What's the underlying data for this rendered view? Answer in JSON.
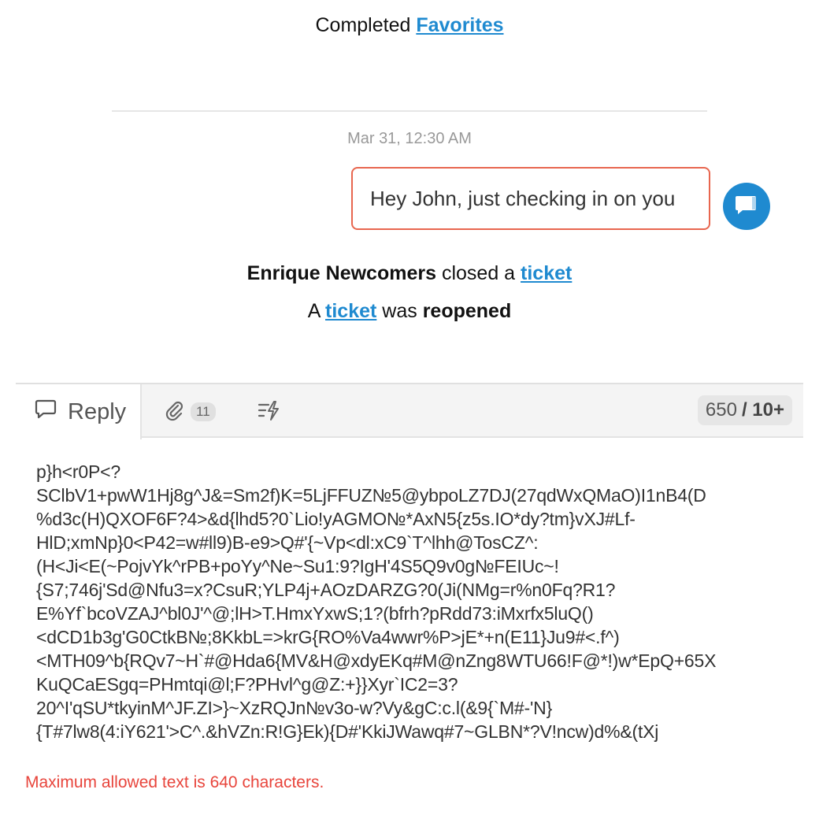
{
  "activity_top": {
    "prefix": "Completed",
    "link": "Favorites"
  },
  "timestamp": "Mar 31, 12:30 AM",
  "message": {
    "text": "Hey John, just checking in on you"
  },
  "events": [
    {
      "actor": "Enrique Newcomers",
      "action": "closed a",
      "link": "ticket"
    },
    {
      "prefix": "A",
      "link": "ticket",
      "middle": "was",
      "status": "reopened"
    }
  ],
  "composer": {
    "reply_label": "Reply",
    "attachment_count": "11",
    "counter_current": "650",
    "counter_limit": "/ 10+",
    "body_lines": [
      "p}h<r0P<?",
      "SClbV1+pwW1Hj8g^J&=Sm2f)K=5LjFFUZ№5@ybpoLZ7DJ(27qdWxQMaO)I1nB4(D",
      "%d3c(H)QXOF6F?4>&d{lhd5?0`Lio!yAGMO№*AxN5{z5s.IO*dy?tm}vXJ#Lf-",
      "HlD;xmNp}0<P42=w#ll9)B-e9>Q#'{~Vp<dl:xC9`T^lhh@TosCZ^:",
      "(H<Ji<E(~PojvYk^rPB+poYy^Ne~Su1:9?IgH'4S5Q9v0g№FEIUc~!",
      "{S7;746j'Sd@Nfu3=x?CsuR;YLP4j+AOzDARZG?0(Ji(NMg=r%n0Fq?R1?",
      "E%Yf`bcoVZAJ^bl0J'^@;lH>T.HmxYxwS;1?(bfrh?pRdd73:iMxrfx5luQ()",
      "<dCD1b3g'G0CtkB№;8KkbL=>krG{RO%Va4wwr%P>jE*+n(E11}Ju9#<.f^)",
      "<MTH09^b{RQv7~H`#@Hda6{MV&H@xdyEKq#M@nZng8WTU66!F@*!)w*EpQ+65X",
      "KuQCaESgq=PHmtqi@l;F?PHvl^g@Z:+}}Xyr`IC2=3?",
      "20^I'qSU*tkyinM^JF.ZI>}~XzRQJn№v3o-w?Vy&gC:c.l(&9{`M#-'N}",
      "{T#7lw8(4:iY621'>C^.&hVZn:R!G}Ek){D#'KkiJWawq#7~GLBN*?V!ncw)d%&(tXj"
    ],
    "error": "Maximum allowed text is 640 characters."
  },
  "colors": {
    "link": "#1f8ad0",
    "bubble_border": "#e8664f",
    "avatar": "#1f8ad0",
    "error": "#e8453c"
  },
  "icons": {
    "avatar": "chat-icon",
    "reply": "speech-bubble-icon",
    "attach": "paperclip-icon",
    "macro": "lightning-list-icon"
  }
}
